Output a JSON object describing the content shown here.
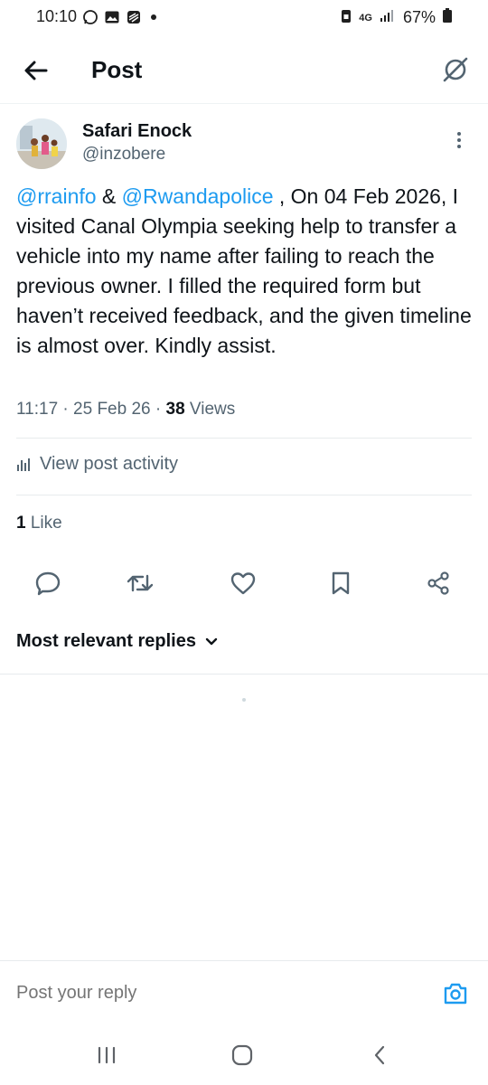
{
  "status_bar": {
    "time": "10:10",
    "network": "4G",
    "battery": "67%",
    "icons": [
      "whatsapp-icon",
      "gallery-icon",
      "stack-icon",
      "dot-icon",
      "lock-icon",
      "signal-icon",
      "battery-icon"
    ]
  },
  "header": {
    "title": "Post",
    "back_icon": "arrow-left-icon",
    "grok_icon": "grok-icon"
  },
  "post": {
    "author_name": "Safari Enock",
    "author_handle": "@inzobere",
    "mention_1": "@rrainfo",
    "connector": " & ",
    "mention_2": "@Rwandapolice",
    "body": " , On 04 Feb 2026, I visited Canal Olympia seeking help to transfer a vehicle into my name after failing to reach the previous owner. I filled the required form but haven’t received feedback, and the given timeline is almost over. Kindly assist.",
    "time": "11:17",
    "sep": " · ",
    "date": "25 Feb 26",
    "views_count": "38",
    "views_label": " Views",
    "activity_label": "View post activity",
    "likes_count": "1",
    "likes_label": " Like"
  },
  "actions": [
    "reply-icon",
    "repost-icon",
    "like-icon",
    "bookmark-icon",
    "share-icon"
  ],
  "replies": {
    "sort_label": "Most relevant replies"
  },
  "reply_bar": {
    "placeholder": "Post your reply"
  },
  "colors": {
    "accent": "#1d9bf0",
    "text": "#0f1419",
    "secondary": "#536471",
    "divider": "#e7ebed"
  }
}
